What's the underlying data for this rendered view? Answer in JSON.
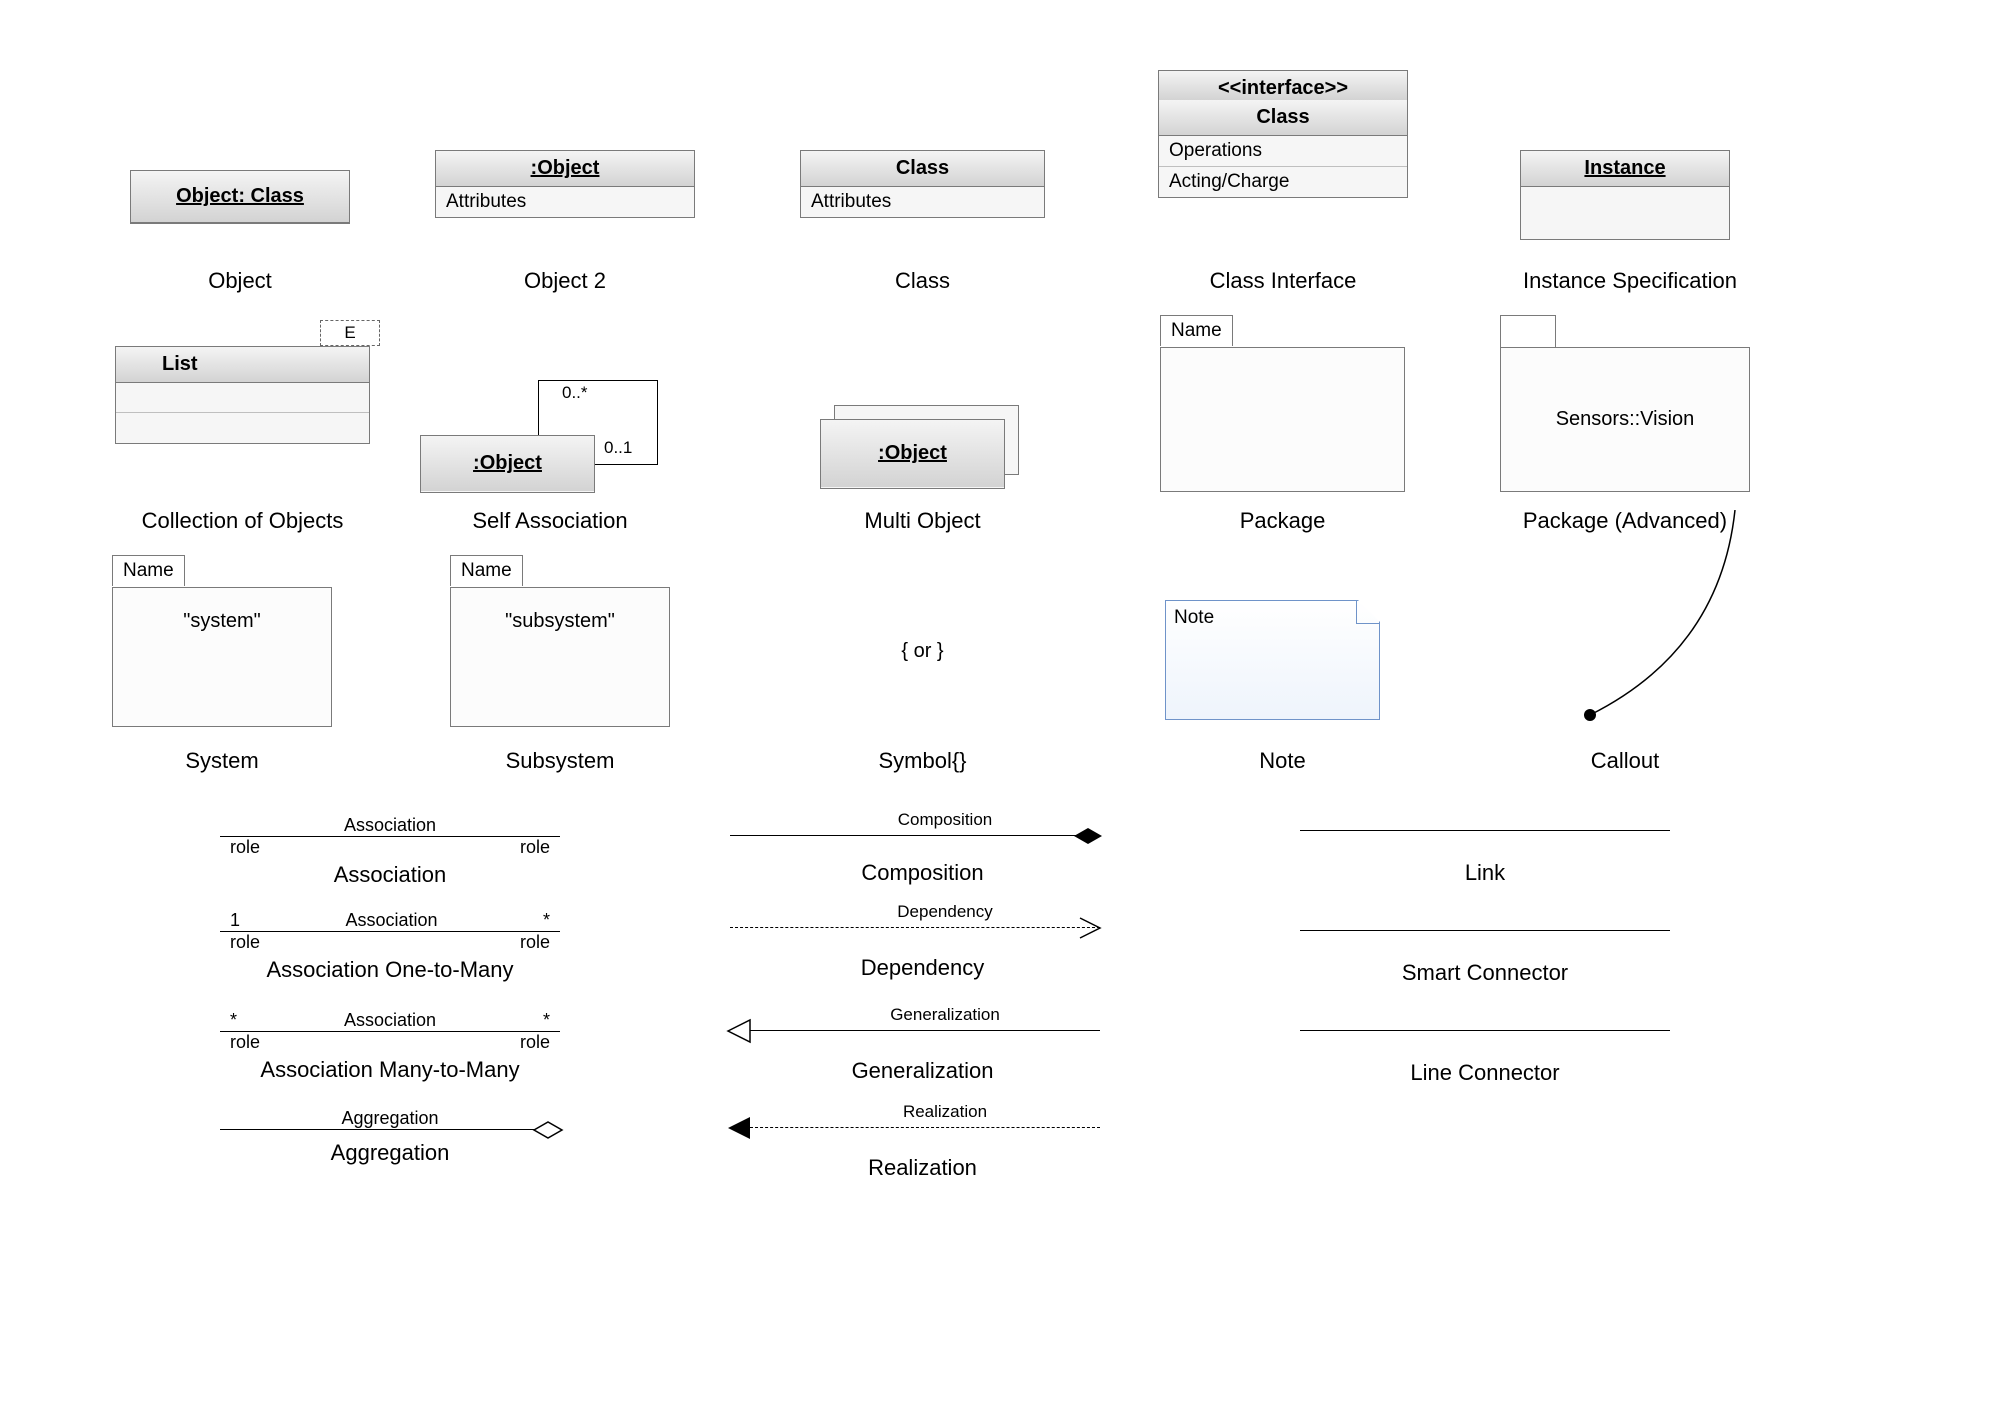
{
  "row1": {
    "object": {
      "title": "Object: Class",
      "caption": "Object"
    },
    "object2": {
      "title": ":Object",
      "attr": "Attributes",
      "caption": "Object 2"
    },
    "class": {
      "title": "Class",
      "attr": "Attributes",
      "caption": "Class"
    },
    "classInterface": {
      "stereo": "<<interface>>",
      "title": "Class",
      "r1": "Operations",
      "r2": "Acting/Charge",
      "caption": "Class Interface"
    },
    "instance": {
      "title": "Instance",
      "caption": "Instance Specification"
    }
  },
  "row2": {
    "collection": {
      "tag": "E",
      "title": "List",
      "caption": "Collection of Objects"
    },
    "selfAssoc": {
      "title": ":Object",
      "m1": "0..*",
      "m2": "0..1",
      "caption": "Self Association"
    },
    "multiObject": {
      "title": ":Object",
      "caption": "Multi Object"
    },
    "package": {
      "tab": "Name",
      "caption": "Package"
    },
    "packageAdv": {
      "body": "Sensors::Vision",
      "caption": "Package (Advanced)"
    }
  },
  "row3": {
    "system": {
      "tab": "Name",
      "body": "\"system\"",
      "caption": "System"
    },
    "subsystem": {
      "tab": "Name",
      "body": "\"subsystem\"",
      "caption": "Subsystem"
    },
    "symbol": {
      "body": "{ or }",
      "caption": "Symbol{}"
    },
    "note": {
      "body": "Note",
      "caption": "Note"
    },
    "callout": {
      "caption": "Callout"
    }
  },
  "assoc": {
    "a1": {
      "top": "Association",
      "roleL": "role",
      "roleR": "role",
      "caption": "Association"
    },
    "a2": {
      "multL": "1",
      "top": "Association",
      "multR": "*",
      "roleL": "role",
      "roleR": "role",
      "caption": "Association One-to-Many"
    },
    "a3": {
      "multL": "*",
      "top": "Association",
      "multR": "*",
      "roleL": "role",
      "roleR": "role",
      "caption": "Association Many-to-Many"
    },
    "agg": {
      "top": "Aggregation",
      "caption": "Aggregation"
    }
  },
  "conn": {
    "composition": {
      "label": "Composition",
      "caption": "Composition"
    },
    "dependency": {
      "label": "Dependency",
      "caption": "Dependency"
    },
    "generalization": {
      "label": "Generalization",
      "caption": "Generalization"
    },
    "realization": {
      "label": "Realization",
      "caption": "Realization"
    },
    "link": {
      "caption": "Link"
    },
    "smart": {
      "caption": "Smart Connector"
    },
    "linec": {
      "caption": "Line Connector"
    }
  }
}
